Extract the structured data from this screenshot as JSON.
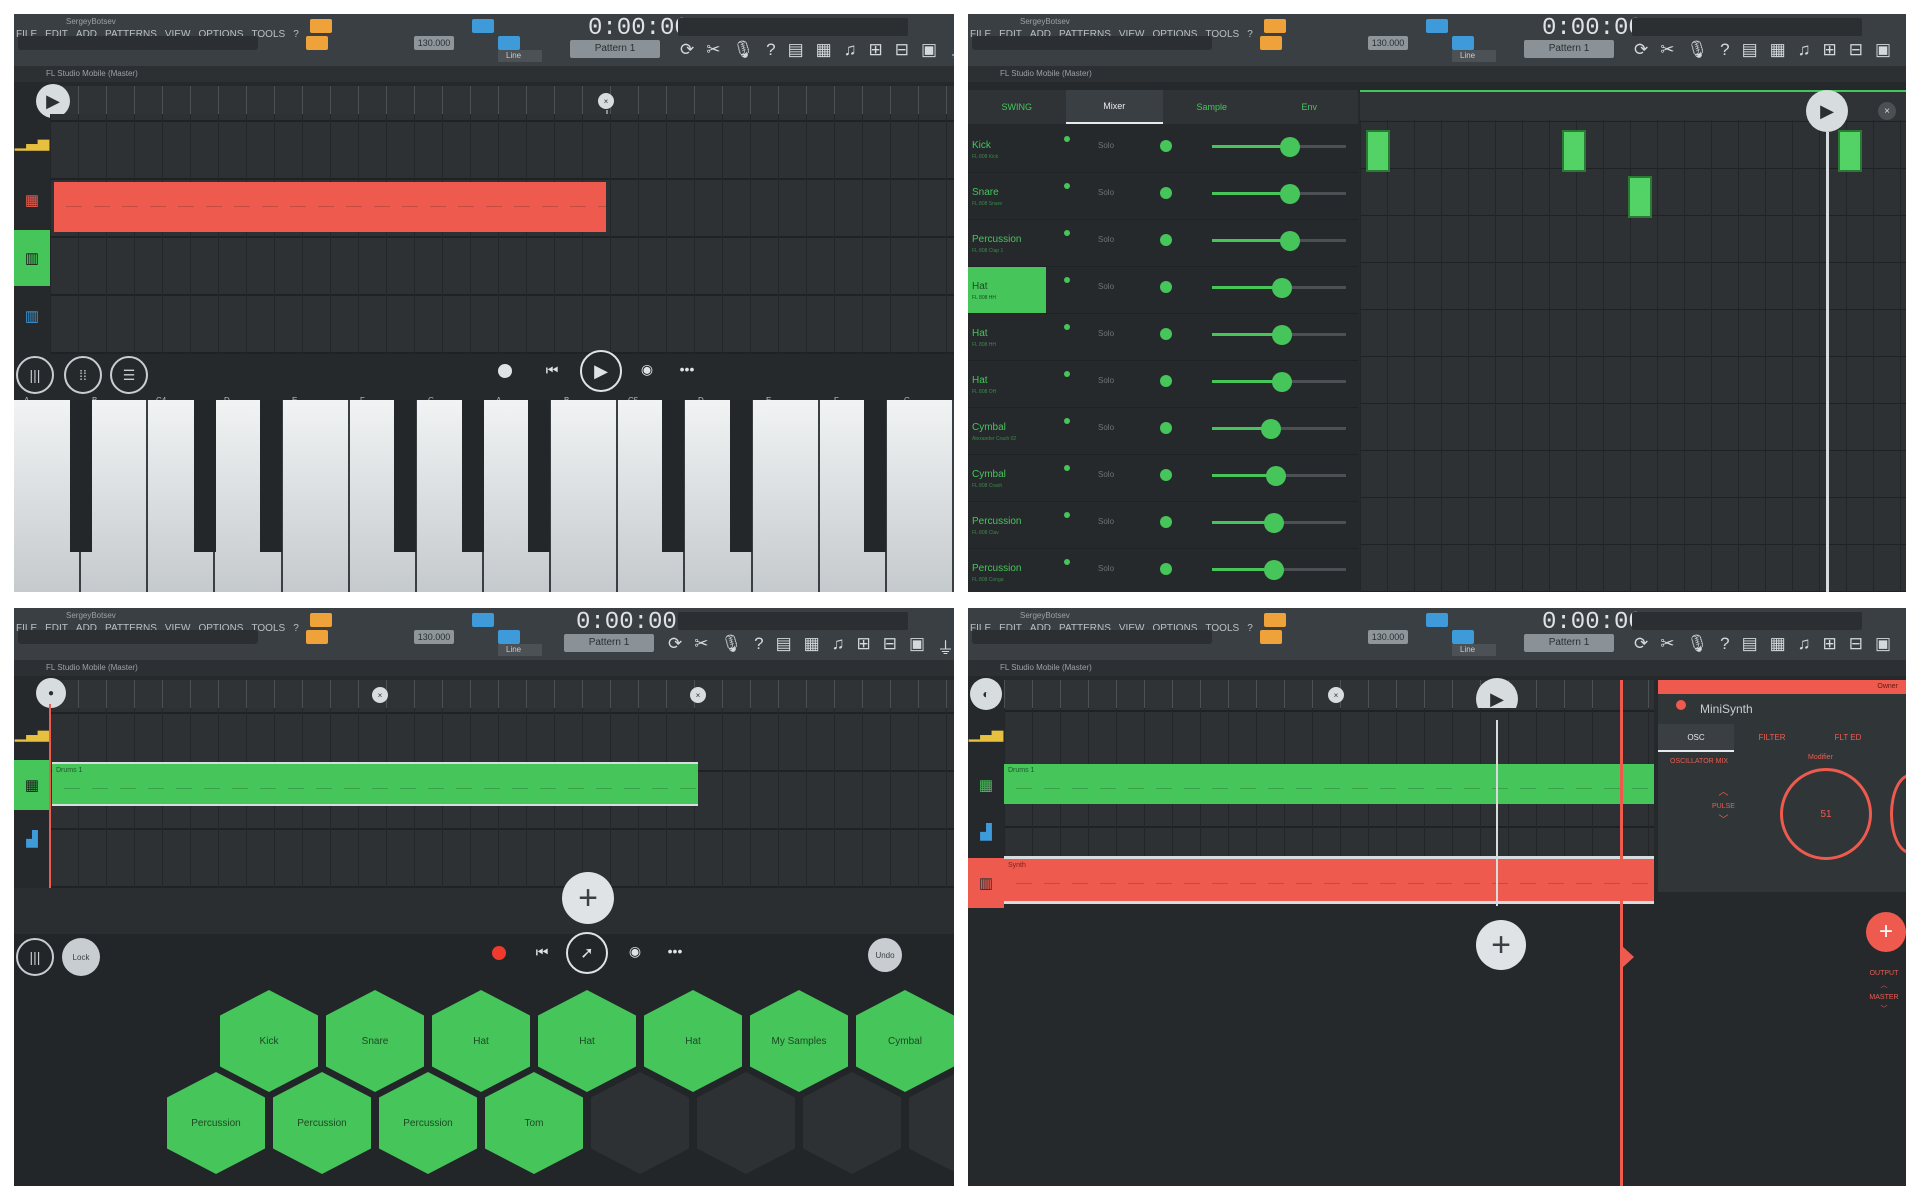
{
  "app": {
    "window_title": "SergeyBotsev",
    "menus": [
      "FILE",
      "EDIT",
      "ADD",
      "PATTERNS",
      "VIEW",
      "OPTIONS",
      "TOOLS",
      "?"
    ],
    "time": "0:00:00",
    "bpm": "130.000",
    "pattern": "Pattern 1",
    "snap": "Line",
    "plugin_title": "FL Studio Mobile (Master)"
  },
  "panel1": {
    "toolbar_icons": [
      "record-icon",
      "skip-back-icon",
      "play-icon",
      "metronome-icon",
      "more-icon"
    ],
    "key_labels": [
      "A",
      "B",
      "C4",
      "D",
      "E",
      "F",
      "G",
      "A",
      "B",
      "C5",
      "D",
      "E",
      "F",
      "G"
    ]
  },
  "panel2": {
    "tabs": [
      "SWING",
      "Mixer",
      "Sample",
      "Env"
    ],
    "solo_label": "Solo",
    "channels": [
      {
        "name": "Kick",
        "sub": "FL 808 Kick",
        "level": 0.58
      },
      {
        "name": "Snare",
        "sub": "FL 808 Snare",
        "level": 0.58
      },
      {
        "name": "Percussion",
        "sub": "FL 808 Clap 1",
        "level": 0.58
      },
      {
        "name": "Hat",
        "sub": "FL 808 HH",
        "level": 0.52,
        "selected": true
      },
      {
        "name": "Hat",
        "sub": "FL 808 HH",
        "level": 0.52
      },
      {
        "name": "Hat",
        "sub": "FL 808 OH",
        "level": 0.52
      },
      {
        "name": "Cymbal",
        "sub": "Alexander Crash 02",
        "level": 0.44
      },
      {
        "name": "Cymbal",
        "sub": "FL 808 Crash",
        "level": 0.48
      },
      {
        "name": "Percussion",
        "sub": "FL 808 Clav",
        "level": 0.46
      },
      {
        "name": "Percussion",
        "sub": "FL 808 Conga",
        "level": 0.46
      }
    ]
  },
  "panel3": {
    "left_buttons": [
      "Lock"
    ],
    "right_button": "Undo",
    "clip_label": "Drums 1",
    "pads": [
      "Kick",
      "Snare",
      "Hat",
      "Hat",
      "Hat",
      "My Samples",
      "Cymbal",
      "Percussion",
      "Percussion",
      "Percussion",
      "Tom"
    ]
  },
  "panel4": {
    "clip_drums": "Drums 1",
    "clip_synth": "Synth",
    "synth_title": "MiniSynth",
    "synth_header": "Owner",
    "synth_tabs": [
      "OSC",
      "FILTER",
      "FLT ED"
    ],
    "osc_label": "OSCILLATOR MIX",
    "wave": "PULSE",
    "knob_label": "Modifier",
    "knob_value": "51",
    "output_label": "OUTPUT",
    "output_value": "MASTER"
  },
  "colors": {
    "green": "#45c55a",
    "red": "#ee5b4e",
    "orange": "#f0a23a",
    "blue": "#3e9ad8",
    "bg": "#26292c"
  }
}
